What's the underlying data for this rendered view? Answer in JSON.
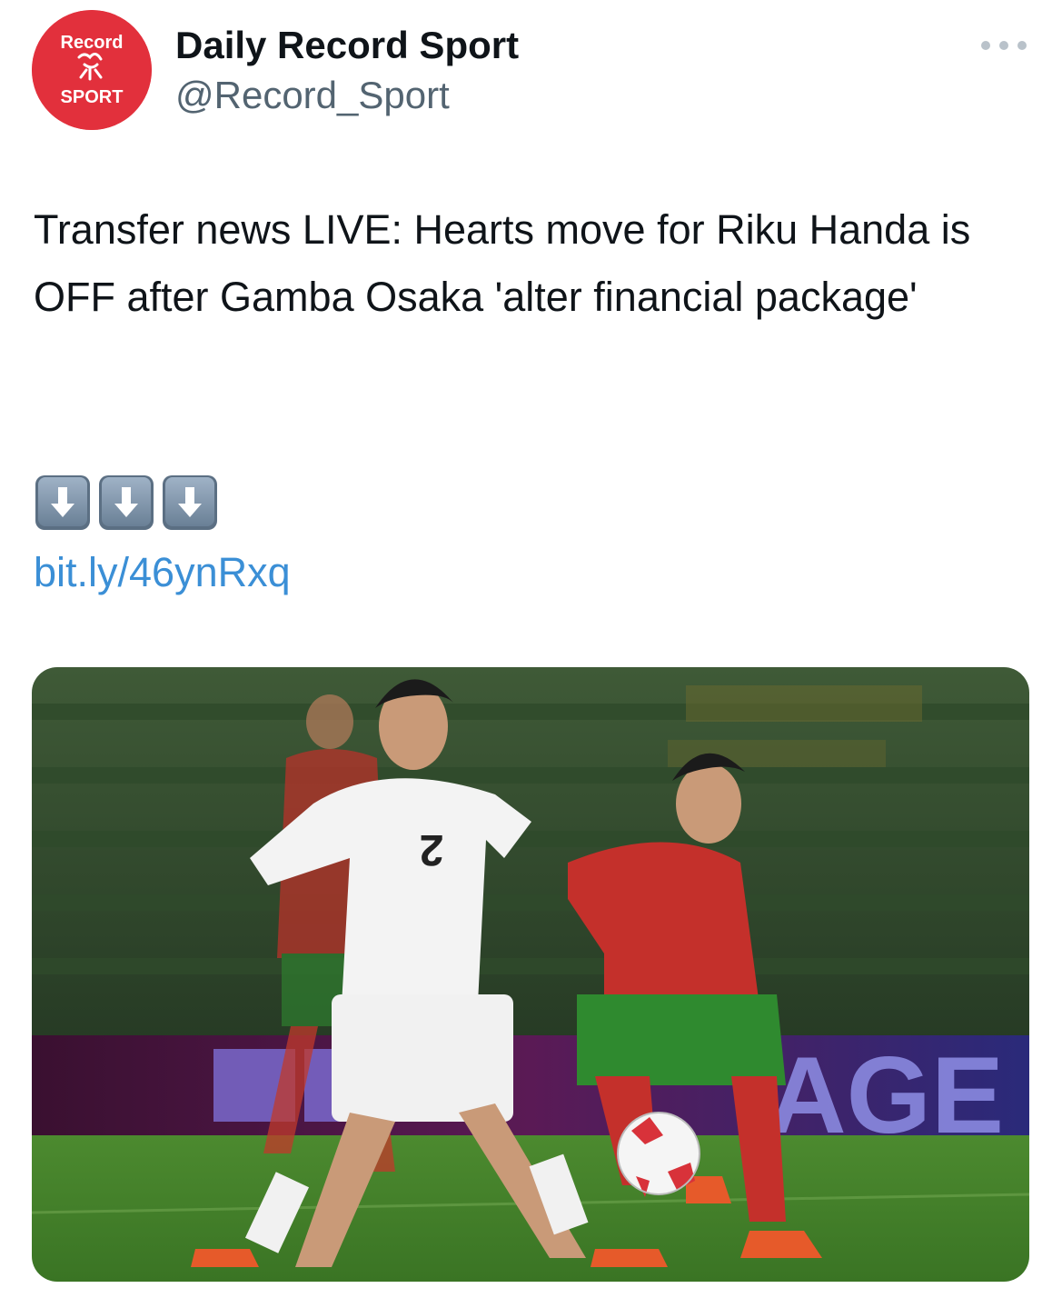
{
  "header": {
    "avatar": {
      "text_top": "Record",
      "text_bottom": "SPORT",
      "background": "#e2303c"
    },
    "display_name": "Daily Record Sport",
    "handle": "@Record_Sport",
    "more_icon": "ellipsis-icon"
  },
  "tweet": {
    "text": "Transfer news LIVE: Hearts move for Riku Handa is OFF after Gamba Osaka 'alter financial package'",
    "emojis": [
      "down-arrow-icon",
      "down-arrow-icon",
      "down-arrow-icon"
    ],
    "link": "bit.ly/46ynRxq"
  },
  "media": {
    "jersey_number": "2",
    "board_text": "AGE"
  },
  "colors": {
    "link": "#3b8fd6",
    "handle": "#536471",
    "brand_red": "#e2303c"
  }
}
